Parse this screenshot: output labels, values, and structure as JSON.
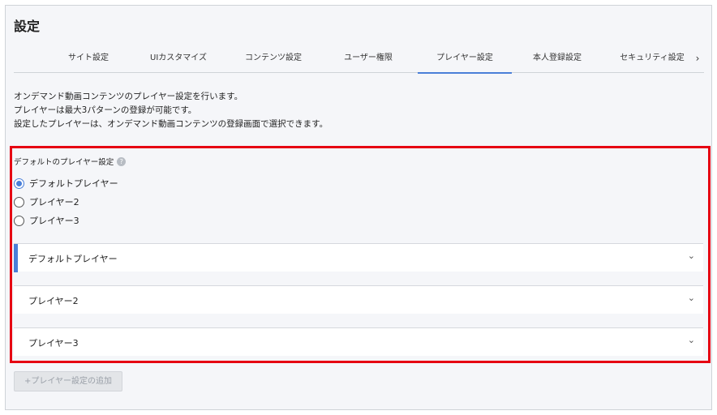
{
  "page": {
    "title": "設定"
  },
  "tabs": [
    {
      "label": "サイト設定"
    },
    {
      "label": "UIカスタマイズ"
    },
    {
      "label": "コンテンツ設定"
    },
    {
      "label": "ユーザー権限"
    },
    {
      "label": "プレイヤー設定",
      "active": true
    },
    {
      "label": "本人登録設定"
    },
    {
      "label": "セキュリティ設定"
    }
  ],
  "tabs_more": {
    "icon": "chevron-right-icon",
    "glyph": "›"
  },
  "description": [
    "オンデマンド動画コンテンツのプレイヤー設定を行います。",
    "プレイヤーは最大3パターンの登録が可能です。",
    "設定したプレイヤーは、オンデマンド動画コンテンツの登録画面で選択できます。"
  ],
  "default_player": {
    "label": "デフォルトのプレイヤー設定",
    "help_icon": "question-icon",
    "help_glyph": "?",
    "options": [
      {
        "label": "デフォルトプレイヤー",
        "checked": true
      },
      {
        "label": "プレイヤー2",
        "checked": false
      },
      {
        "label": "プレイヤー3",
        "checked": false
      }
    ]
  },
  "accordion": [
    {
      "label": "デフォルトプレイヤー",
      "icon": "chevron-down-icon",
      "glyph": "⌄"
    },
    {
      "label": "プレイヤー2",
      "icon": "chevron-down-icon",
      "glyph": "⌄"
    },
    {
      "label": "プレイヤー3",
      "icon": "chevron-down-icon",
      "glyph": "⌄"
    }
  ],
  "add_button": {
    "label": "+プレイヤー設定の追加"
  },
  "colors": {
    "accent": "#4a7fd8",
    "highlight_border": "#e60012",
    "background": "#f5f6f9"
  }
}
